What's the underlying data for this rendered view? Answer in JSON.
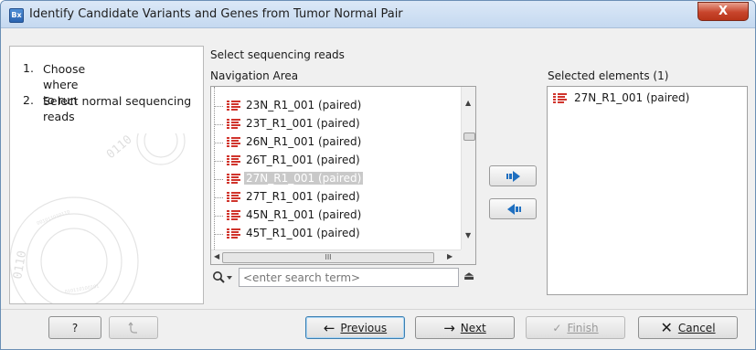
{
  "window": {
    "app_icon": "Bx",
    "title": "Identify Candidate Variants and Genes from Tumor Normal Pair",
    "close_label": "X"
  },
  "steps": [
    {
      "num": "1.",
      "label": "Choose where to run"
    },
    {
      "num": "2.",
      "label": "Select normal sequencing reads"
    }
  ],
  "main": {
    "section_title": "Select sequencing reads",
    "nav_label": "Navigation Area",
    "selected_label": "Selected elements (1)"
  },
  "navigation": {
    "items": [
      {
        "label": "23N_R1_001 (paired)",
        "icon": "sequence-list-icon",
        "selected": false
      },
      {
        "label": "23T_R1_001 (paired)",
        "icon": "sequence-list-icon",
        "selected": false
      },
      {
        "label": "26N_R1_001 (paired)",
        "icon": "sequence-list-icon",
        "selected": false
      },
      {
        "label": "26T_R1_001 (paired)",
        "icon": "sequence-list-icon",
        "selected": false
      },
      {
        "label": "27N_R1_001 (paired)",
        "icon": "sequence-list-icon",
        "selected": true
      },
      {
        "label": "27T_R1_001 (paired)",
        "icon": "sequence-list-icon",
        "selected": false
      },
      {
        "label": "45N_R1_001 (paired)",
        "icon": "sequence-list-icon",
        "selected": false
      },
      {
        "label": "45T_R1_001 (paired)",
        "icon": "sequence-list-icon",
        "selected": false
      }
    ],
    "hscroll_grip": "III"
  },
  "search": {
    "placeholder": "<enter search term>"
  },
  "selected": {
    "items": [
      {
        "label": "27N_R1_001 (paired)",
        "icon": "sequence-list-icon"
      }
    ]
  },
  "footer": {
    "help_label": "?",
    "previous_label": "Previous",
    "next_label": "Next",
    "finish_label": "Finish",
    "cancel_label": "Cancel"
  },
  "colors": {
    "sequence_icon": "#d0342c",
    "arrow_blue": "#1f6fc0",
    "selection_gray": "#c9c9c9"
  }
}
